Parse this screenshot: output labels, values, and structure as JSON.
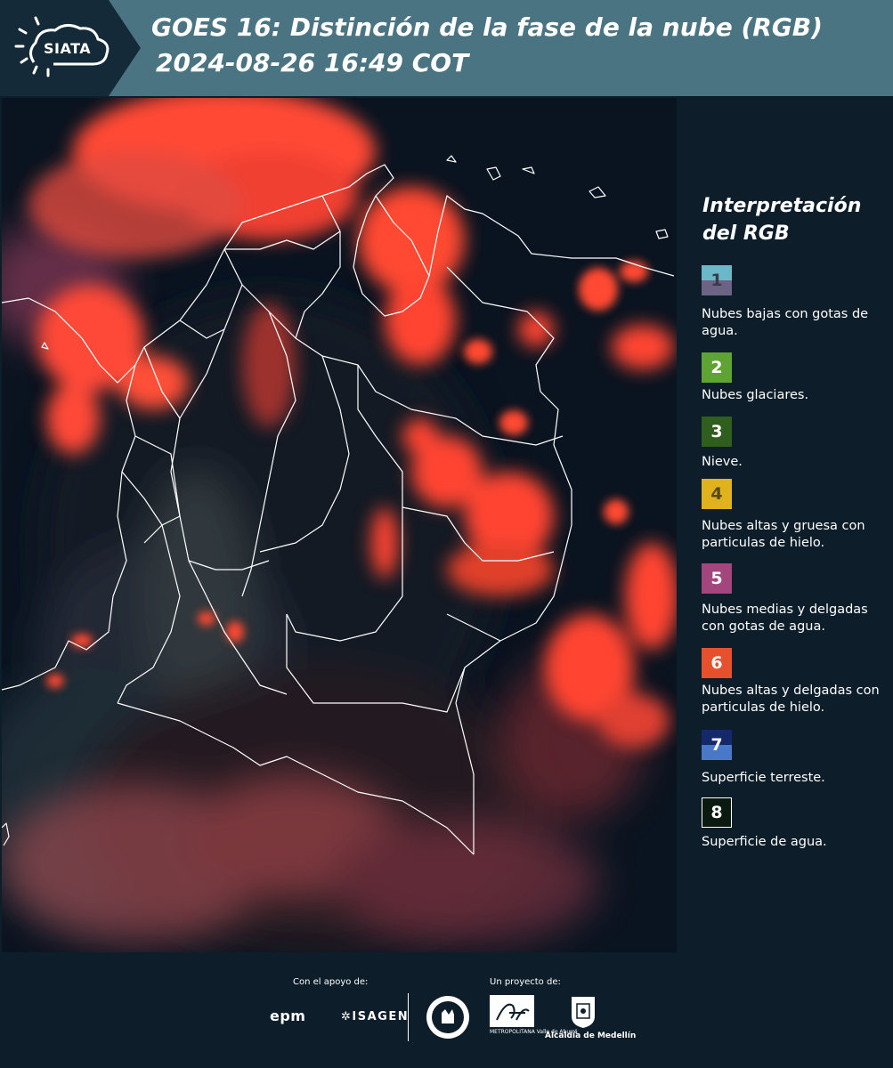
{
  "header": {
    "logo_text": "SIATA",
    "title_line1": "GOES 16: Distinción de la fase de la nube (RGB)",
    "title_line2": "2024-08-26 16:49 COT"
  },
  "legend": {
    "title_line1": "Interpretación",
    "title_line2": "del RGB",
    "items": [
      {
        "number": "1",
        "label": "Nubes bajas con gotas de agua.",
        "color_top": "#6bb8c8",
        "color_bottom": "#6d6384",
        "text_color": "#3a3a4a"
      },
      {
        "number": "2",
        "label": "Nubes glaciares.",
        "color_top": "#5ea334",
        "color_bottom": "#5ea334",
        "text_color": "#ffffff"
      },
      {
        "number": "3",
        "label": "Nieve.",
        "color_top": "#2f5e1e",
        "color_bottom": "#2f5e1e",
        "text_color": "#ffffff"
      },
      {
        "number": "4",
        "label": "Nubes altas y gruesa con particulas de hielo.",
        "color_top": "#e0b21e",
        "color_bottom": "#e0b21e",
        "text_color": "#5a4a10"
      },
      {
        "number": "5",
        "label": "Nubes medias y delgadas con gotas de agua.",
        "color_top": "#a4467e",
        "color_bottom": "#a4467e",
        "text_color": "#ffffff"
      },
      {
        "number": "6",
        "label": "Nubes altas y delgadas con particulas de hielo.",
        "color_top": "#e6502c",
        "color_bottom": "#e6502c",
        "text_color": "#ffffff"
      },
      {
        "number": "7",
        "label": "Superficie terreste.",
        "color_top": "#15286a",
        "color_bottom": "#4a78c8",
        "text_color": "#ffffff"
      },
      {
        "number": "8",
        "label": "Superficie de agua.",
        "color_top": "#0a1a10",
        "color_bottom": "#0a1a10",
        "text_color": "#ffffff"
      }
    ]
  },
  "footer": {
    "support_caption": "Con el apoyo de:",
    "project_caption": "Un proyecto de:",
    "sponsor_epm": "epm",
    "sponsor_isagen": "ISAGEN",
    "area_logo_subtext": "METROPOLITANA Valle de Aburrá",
    "alcaldia_label": "Alcaldía de Medellín"
  },
  "colors": {
    "header_bg": "#4a7482",
    "body_bg": "#0d1d2a",
    "cloud_red": "#ff4530"
  }
}
